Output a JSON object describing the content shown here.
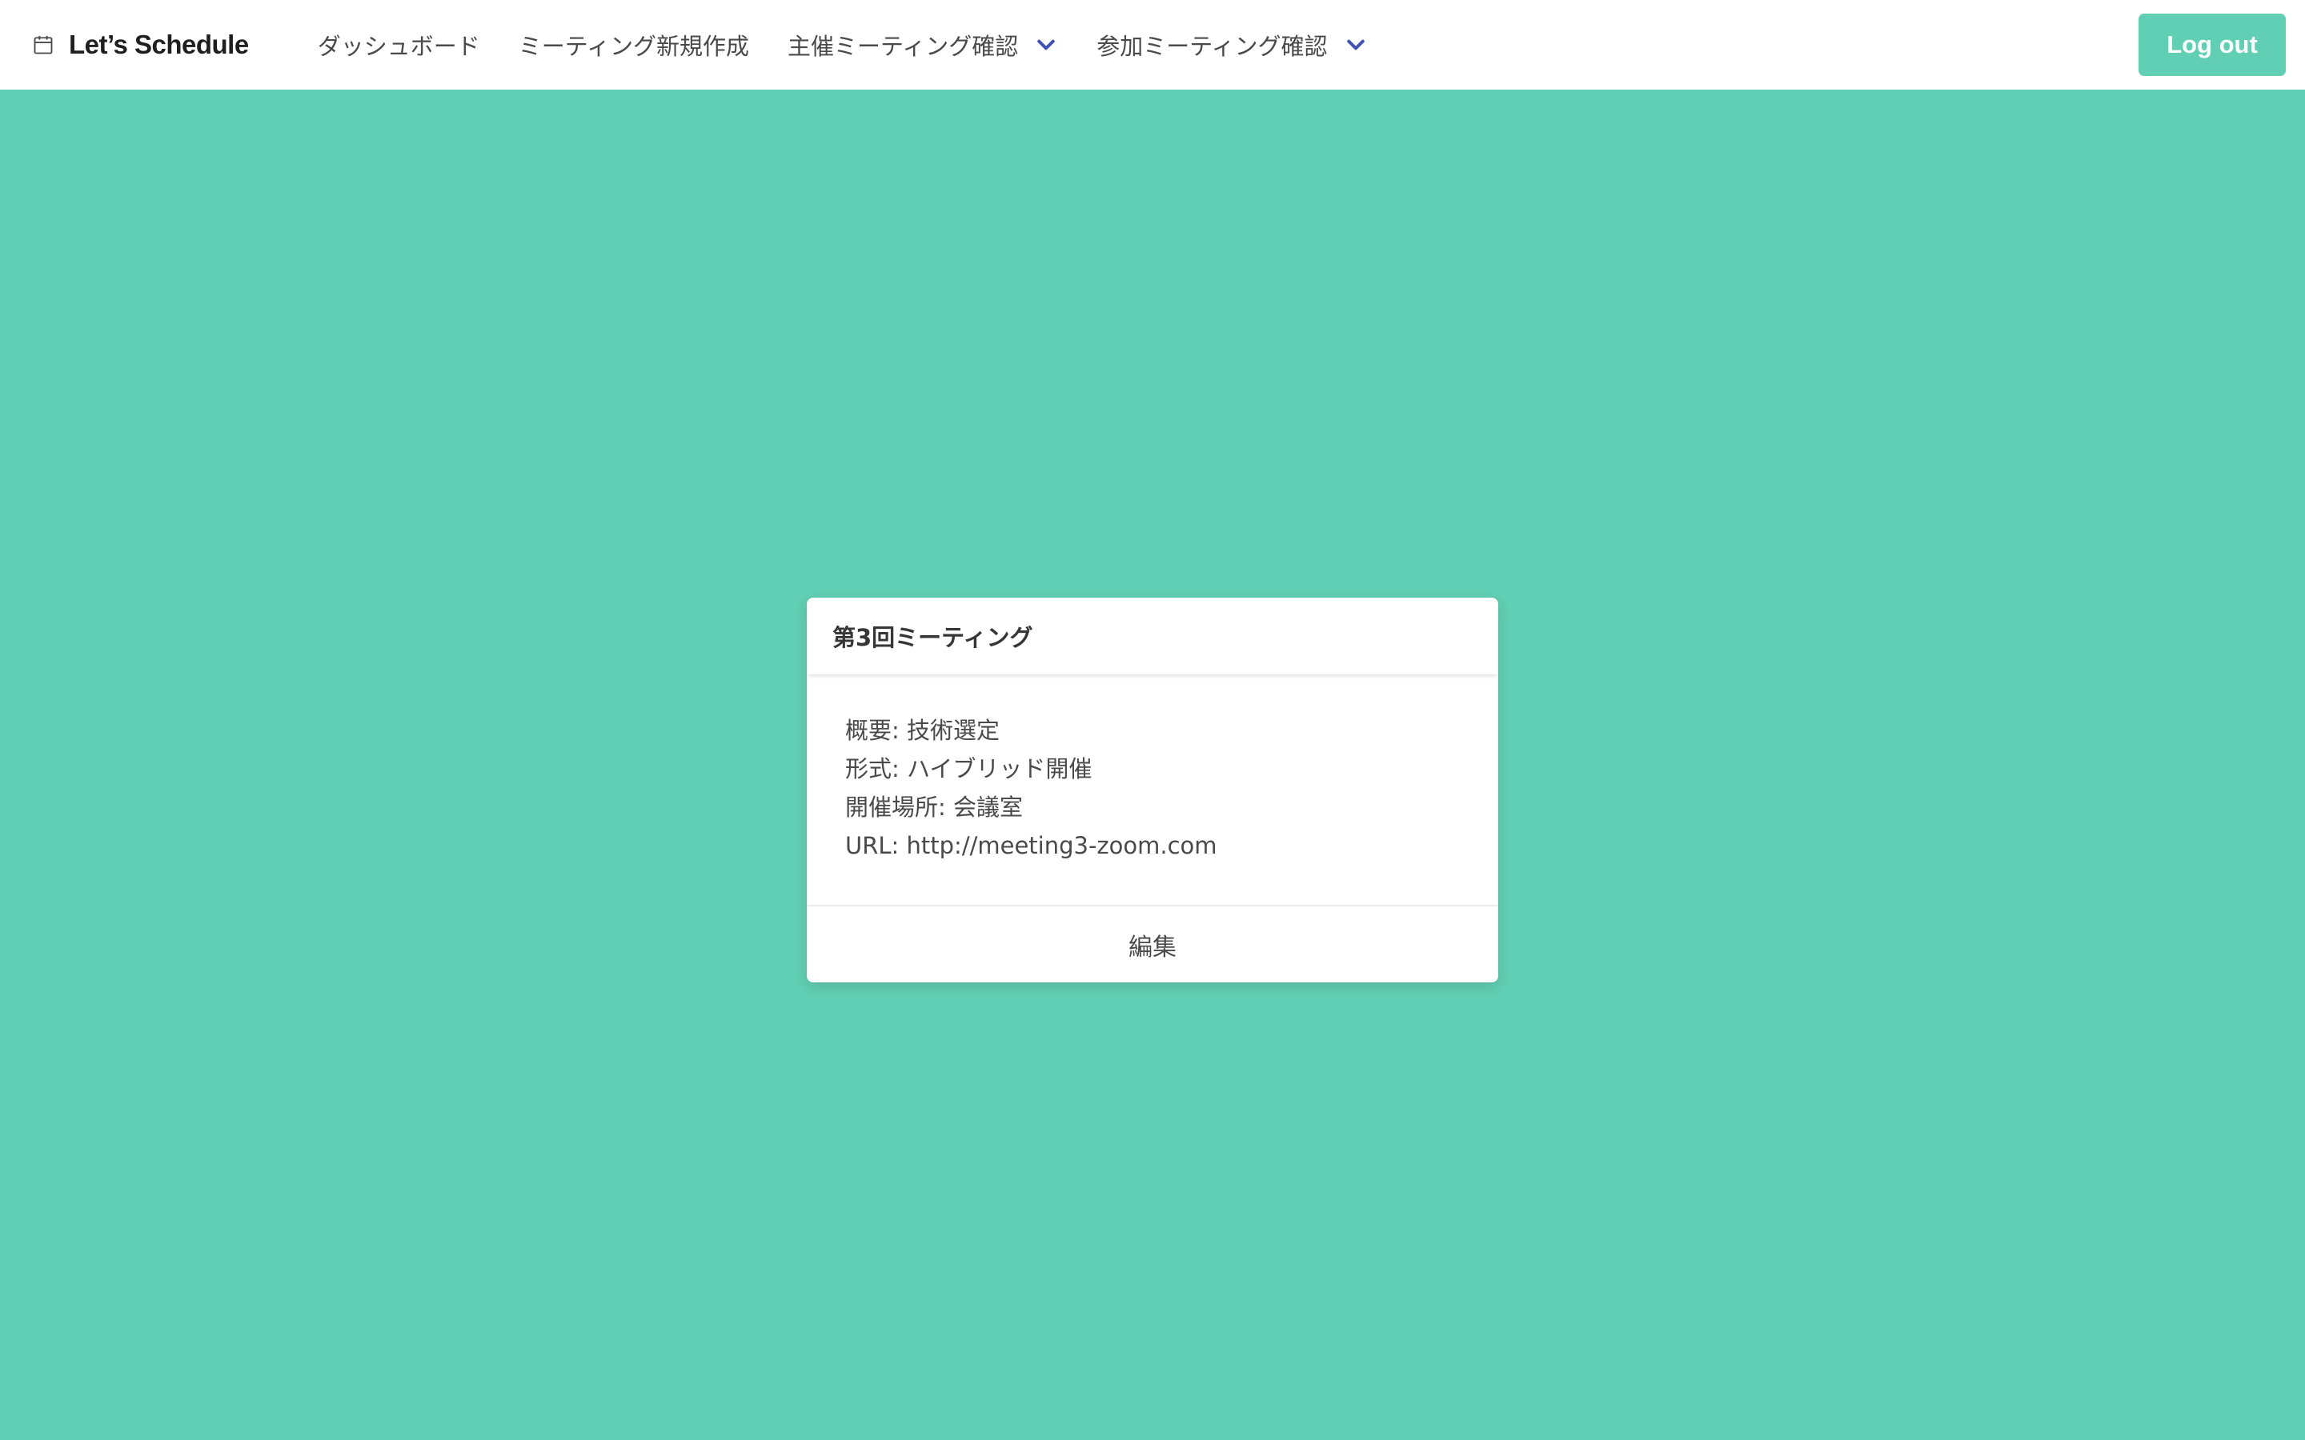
{
  "colors": {
    "accent": "#61cfb3",
    "chevron": "#3f51b5",
    "navbar_bg": "#ffffff"
  },
  "navbar": {
    "brand": {
      "icon": "calendar-icon",
      "title": "Let’s Schedule"
    },
    "items": [
      {
        "label": "ダッシュボード"
      },
      {
        "label": "ミーティング新規作成"
      },
      {
        "label": "主催ミーティング確認",
        "icon": "chevron-down-icon"
      },
      {
        "label": "参加ミーティング確認",
        "icon": "chevron-down-icon"
      }
    ],
    "logout_label": "Log out"
  },
  "meeting_card": {
    "title": "第3回ミーティング",
    "lines": [
      "概要: 技術選定",
      "形式: ハイブリッド開催",
      "開催場所: 会議室",
      "URL: http://meeting3-zoom.com"
    ],
    "footer_link": "編集"
  }
}
